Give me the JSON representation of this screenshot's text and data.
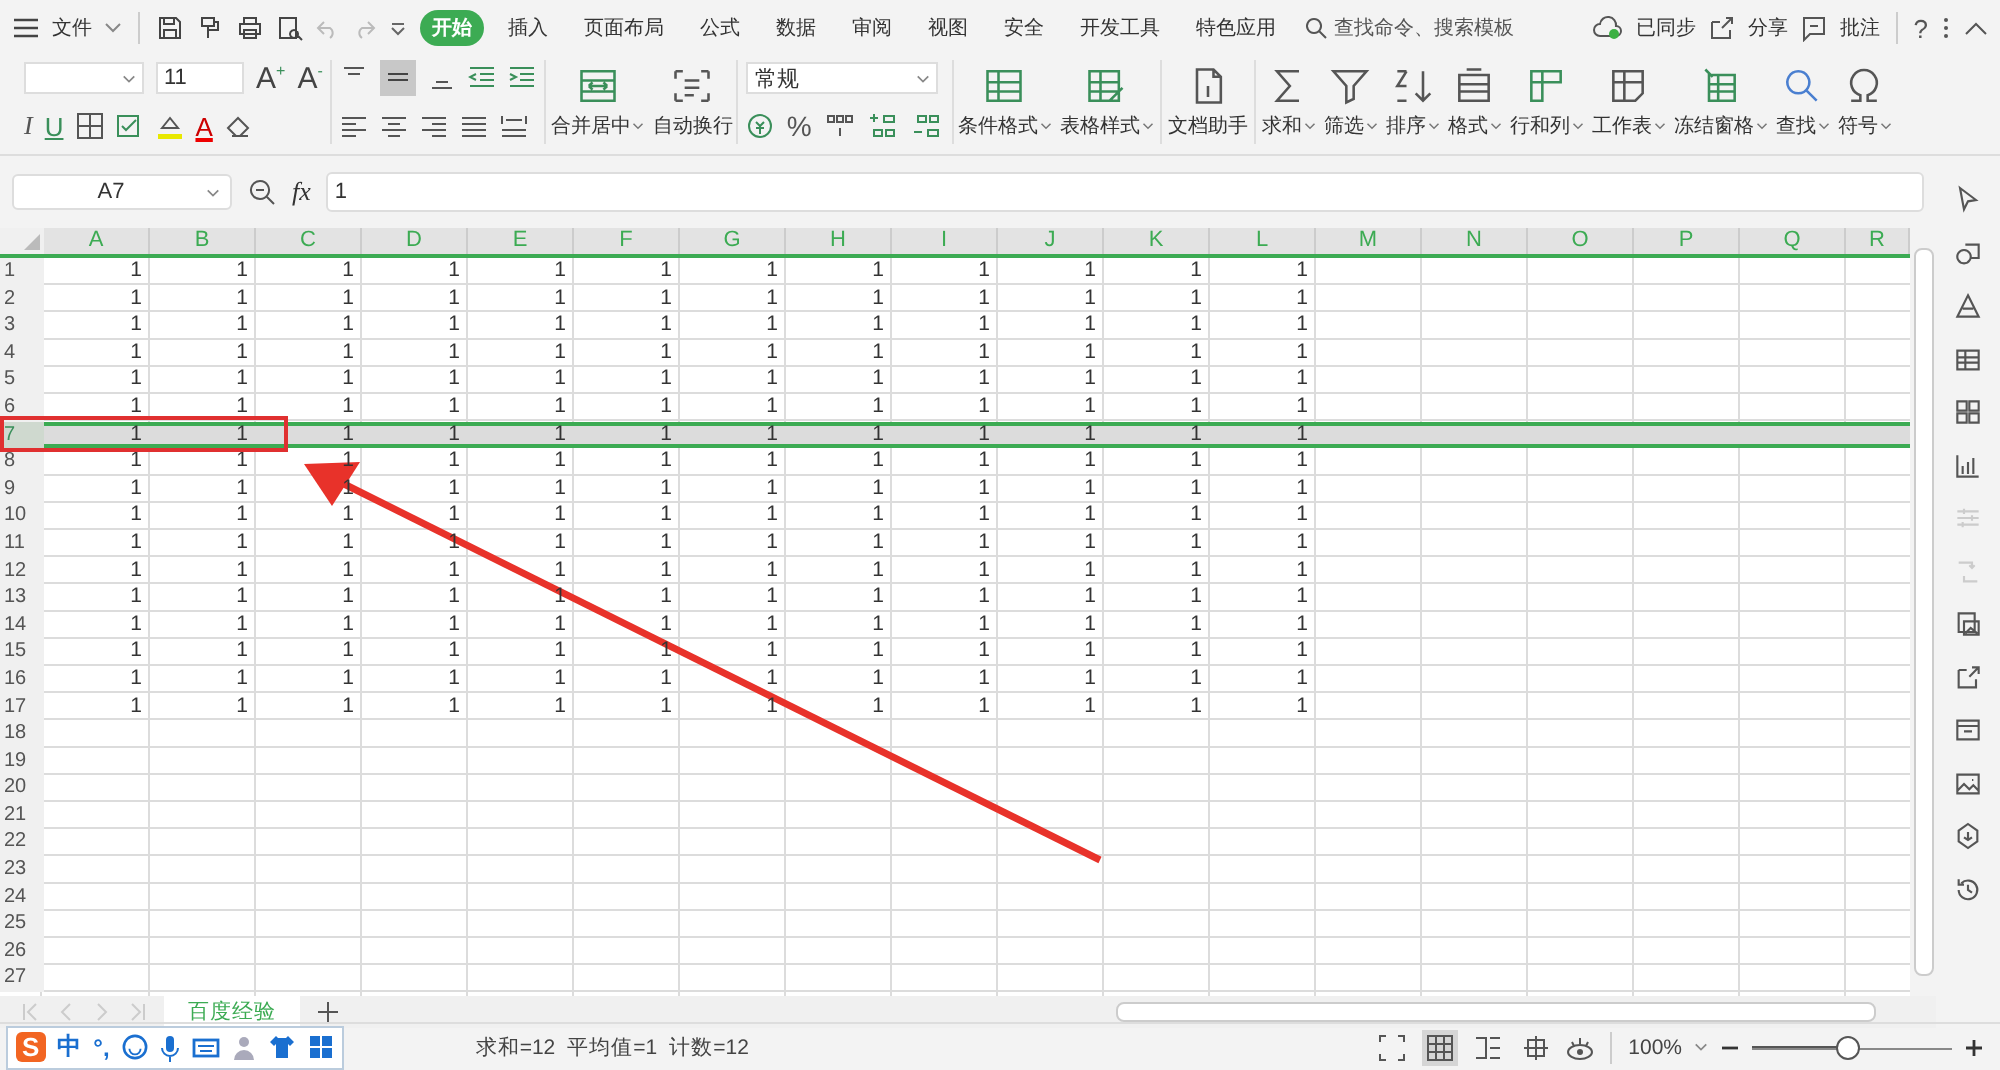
{
  "menu": {
    "file": "文件",
    "tabs": [
      {
        "label": "开始",
        "selected": true
      },
      {
        "label": "插入",
        "selected": false
      },
      {
        "label": "页面布局",
        "selected": false
      },
      {
        "label": "公式",
        "selected": false
      },
      {
        "label": "数据",
        "selected": false
      },
      {
        "label": "审阅",
        "selected": false
      },
      {
        "label": "视图",
        "selected": false
      },
      {
        "label": "安全",
        "selected": false
      },
      {
        "label": "开发工具",
        "selected": false
      },
      {
        "label": "特色应用",
        "selected": false
      }
    ],
    "search_placeholder": "查找命令、搜索模板",
    "sync": "已同步",
    "share": "分享",
    "comment": "批注",
    "help": "?"
  },
  "ribbon": {
    "font_size": "11",
    "grow": "A$^{+}$",
    "shrink": "A$^{-}$",
    "italic": "I",
    "underline": "U",
    "font_color": "A",
    "number_format": "常规",
    "percent": "%",
    "merge_buttons": [
      {
        "label": "合并居中",
        "dropdown": true
      },
      {
        "label": "自动换行",
        "dropdown": false
      }
    ],
    "style_buttons": [
      {
        "label": "条件格式",
        "dropdown": true
      },
      {
        "label": "表格样式",
        "dropdown": true
      }
    ],
    "assistant_button": {
      "label": "文档助手",
      "dropdown": false
    },
    "edit_buttons": [
      {
        "label": "求和",
        "dropdown": true
      },
      {
        "label": "筛选",
        "dropdown": true
      },
      {
        "label": "排序",
        "dropdown": true
      },
      {
        "label": "格式",
        "dropdown": true
      },
      {
        "label": "行和列",
        "dropdown": true
      },
      {
        "label": "工作表",
        "dropdown": true
      },
      {
        "label": "冻结窗格",
        "dropdown": true
      },
      {
        "label": "查找",
        "dropdown": true
      },
      {
        "label": "符号",
        "dropdown": true
      }
    ]
  },
  "formula_bar": {
    "cell_ref": "A7",
    "fx": "fx",
    "value": "1"
  },
  "sheet": {
    "columns": [
      "A",
      "B",
      "C",
      "D",
      "E",
      "F",
      "G",
      "H",
      "I",
      "J",
      "K",
      "L",
      "M",
      "N",
      "O",
      "P",
      "Q",
      "R"
    ],
    "rows": [
      {
        "number": "1",
        "selected": false,
        "cells": [
          "1",
          "1",
          "1",
          "1",
          "1",
          "1",
          "1",
          "1",
          "1",
          "1",
          "1",
          "1"
        ]
      },
      {
        "number": "2",
        "selected": false,
        "cells": [
          "1",
          "1",
          "1",
          "1",
          "1",
          "1",
          "1",
          "1",
          "1",
          "1",
          "1",
          "1"
        ]
      },
      {
        "number": "3",
        "selected": false,
        "cells": [
          "1",
          "1",
          "1",
          "1",
          "1",
          "1",
          "1",
          "1",
          "1",
          "1",
          "1",
          "1"
        ]
      },
      {
        "number": "4",
        "selected": false,
        "cells": [
          "1",
          "1",
          "1",
          "1",
          "1",
          "1",
          "1",
          "1",
          "1",
          "1",
          "1",
          "1"
        ]
      },
      {
        "number": "5",
        "selected": false,
        "cells": [
          "1",
          "1",
          "1",
          "1",
          "1",
          "1",
          "1",
          "1",
          "1",
          "1",
          "1",
          "1"
        ]
      },
      {
        "number": "6",
        "selected": false,
        "cells": [
          "1",
          "1",
          "1",
          "1",
          "1",
          "1",
          "1",
          "1",
          "1",
          "1",
          "1",
          "1"
        ]
      },
      {
        "number": "7",
        "selected": true,
        "cells": [
          "1",
          "1",
          "1",
          "1",
          "1",
          "1",
          "1",
          "1",
          "1",
          "1",
          "1",
          "1"
        ]
      },
      {
        "number": "8",
        "selected": false,
        "cells": [
          "1",
          "1",
          "1",
          "1",
          "1",
          "1",
          "1",
          "1",
          "1",
          "1",
          "1",
          "1"
        ]
      },
      {
        "number": "9",
        "selected": false,
        "cells": [
          "1",
          "1",
          "1",
          "1",
          "1",
          "1",
          "1",
          "1",
          "1",
          "1",
          "1",
          "1"
        ]
      },
      {
        "number": "10",
        "selected": false,
        "cells": [
          "1",
          "1",
          "1",
          "1",
          "1",
          "1",
          "1",
          "1",
          "1",
          "1",
          "1",
          "1"
        ]
      },
      {
        "number": "11",
        "selected": false,
        "cells": [
          "1",
          "1",
          "1",
          "1",
          "1",
          "1",
          "1",
          "1",
          "1",
          "1",
          "1",
          "1"
        ]
      },
      {
        "number": "12",
        "selected": false,
        "cells": [
          "1",
          "1",
          "1",
          "1",
          "1",
          "1",
          "1",
          "1",
          "1",
          "1",
          "1",
          "1"
        ]
      },
      {
        "number": "13",
        "selected": false,
        "cells": [
          "1",
          "1",
          "1",
          "1",
          "1",
          "1",
          "1",
          "1",
          "1",
          "1",
          "1",
          "1"
        ]
      },
      {
        "number": "14",
        "selected": false,
        "cells": [
          "1",
          "1",
          "1",
          "1",
          "1",
          "1",
          "1",
          "1",
          "1",
          "1",
          "1",
          "1"
        ]
      },
      {
        "number": "15",
        "selected": false,
        "cells": [
          "1",
          "1",
          "1",
          "1",
          "1",
          "1",
          "1",
          "1",
          "1",
          "1",
          "1",
          "1"
        ]
      },
      {
        "number": "16",
        "selected": false,
        "cells": [
          "1",
          "1",
          "1",
          "1",
          "1",
          "1",
          "1",
          "1",
          "1",
          "1",
          "1",
          "1"
        ]
      },
      {
        "number": "17",
        "selected": false,
        "cells": [
          "1",
          "1",
          "1",
          "1",
          "1",
          "1",
          "1",
          "1",
          "1",
          "1",
          "1",
          "1"
        ]
      },
      {
        "number": "18",
        "selected": false
      },
      {
        "number": "19",
        "selected": false
      },
      {
        "number": "20",
        "selected": false
      },
      {
        "number": "21",
        "selected": false
      },
      {
        "number": "22",
        "selected": false
      },
      {
        "number": "23",
        "selected": false
      },
      {
        "number": "24",
        "selected": false
      },
      {
        "number": "25",
        "selected": false
      },
      {
        "number": "26",
        "selected": false
      },
      {
        "number": "27",
        "selected": false
      }
    ]
  },
  "sheet_tabs": [
    {
      "label": "百度经验",
      "selected": true
    }
  ],
  "sidebar_tools": [
    {
      "disabled": false
    },
    {
      "disabled": false
    },
    {
      "disabled": false
    },
    {
      "disabled": false
    },
    {
      "disabled": false
    },
    {
      "disabled": false
    },
    {
      "disabled": true
    },
    {
      "disabled": true
    },
    {
      "disabled": false
    },
    {
      "disabled": false
    },
    {
      "disabled": false
    },
    {
      "disabled": false
    },
    {
      "disabled": false
    },
    {
      "disabled": false
    }
  ],
  "ime_bar": {
    "logo": "S",
    "language": "中",
    "punctuation": "°,"
  },
  "status_bar": {
    "sum": "求和=12",
    "average": "平均值=1",
    "count": "计数=12",
    "view_modes": [
      {
        "selected": false
      },
      {
        "selected": true
      },
      {
        "selected": false
      },
      {
        "selected": false
      }
    ],
    "zoom": "100%",
    "zoom_slider": {
      "level": 0.48
    }
  }
}
